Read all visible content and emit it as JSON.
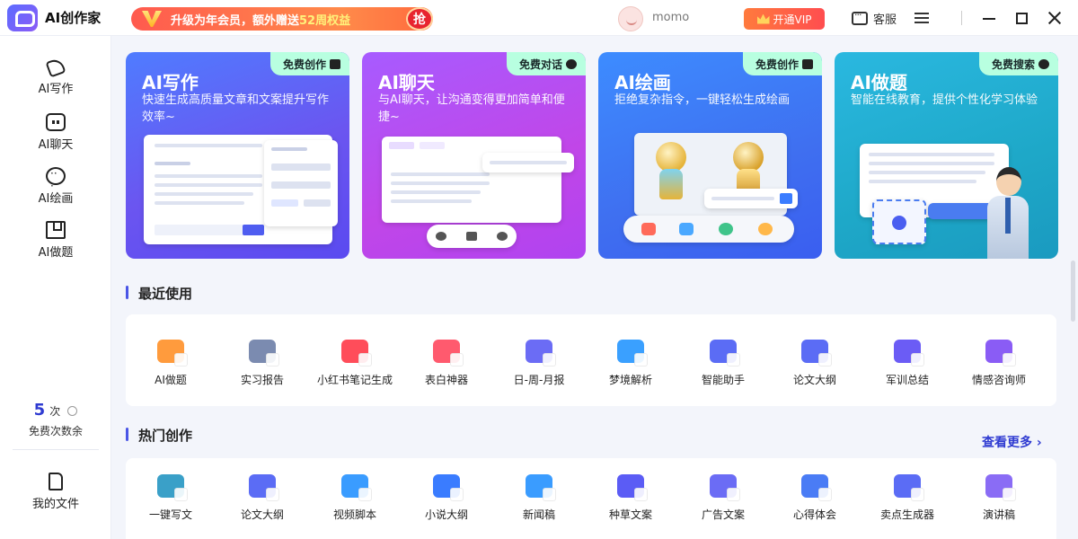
{
  "app": {
    "title": "AI创作家"
  },
  "banner": {
    "text_a": "升级为年会员，额外赠送",
    "text_highlight": "52周权益",
    "grab": "抢"
  },
  "user": {
    "name": "momo"
  },
  "header": {
    "vip_button": "开通VIP",
    "service": "客服"
  },
  "sidebar": {
    "items": [
      {
        "label": "AI写作",
        "icon": "pen-icon"
      },
      {
        "label": "AI聊天",
        "icon": "robot-icon"
      },
      {
        "label": "AI绘画",
        "icon": "palette-icon"
      },
      {
        "label": "AI做题",
        "icon": "book-icon"
      }
    ],
    "free_count": "5",
    "free_unit": "次",
    "free_label": "免费次数余",
    "files_label": "我的文件"
  },
  "cards": [
    {
      "title": "AI写作",
      "tag": "免费创作",
      "desc": "快速生成高质量文章和文案提升写作效率~",
      "color": "#5a63f0"
    },
    {
      "title": "AI聊天",
      "tag": "免费对话",
      "desc": "与AI聊天，让沟通变得更加简单和便捷~",
      "color": "#b94ee8"
    },
    {
      "title": "AI绘画",
      "tag": "免费创作",
      "desc": "拒绝复杂指令，一键轻松生成绘画",
      "color": "#3f6ff0"
    },
    {
      "title": "AI做题",
      "tag": "免费搜索",
      "desc": "智能在线教育，提供个性化学习体验",
      "color": "#1ea8c8"
    }
  ],
  "recent": {
    "title": "最近使用",
    "items": [
      {
        "label": "AI做题",
        "color": "#ff9b3d"
      },
      {
        "label": "实习报告",
        "color": "#7b8bb0"
      },
      {
        "label": "小红书笔记生成",
        "color": "#ff4d5a"
      },
      {
        "label": "表白神器",
        "color": "#ff5a6e"
      },
      {
        "label": "日-周-月报",
        "color": "#6b6cf5"
      },
      {
        "label": "梦境解析",
        "color": "#3aa0ff"
      },
      {
        "label": "智能助手",
        "color": "#5b6cf5"
      },
      {
        "label": "论文大纲",
        "color": "#5b6cf5"
      },
      {
        "label": "军训总结",
        "color": "#6b5cf5"
      },
      {
        "label": "情感咨询师",
        "color": "#8a5cf5"
      }
    ]
  },
  "hot": {
    "title": "热门创作",
    "see_more": "查看更多 ›",
    "items": [
      {
        "label": "一键写文",
        "color": "#3aa0c8"
      },
      {
        "label": "论文大纲",
        "color": "#5b6cf5"
      },
      {
        "label": "视频脚本",
        "color": "#3a9cff"
      },
      {
        "label": "小说大纲",
        "color": "#3a7cff"
      },
      {
        "label": "新闻稿",
        "color": "#3a9cff"
      },
      {
        "label": "种草文案",
        "color": "#5b5cf5"
      },
      {
        "label": "广告文案",
        "color": "#6b6cf5"
      },
      {
        "label": "心得体会",
        "color": "#4a7cf5"
      },
      {
        "label": "卖点生成器",
        "color": "#5b6cf5"
      },
      {
        "label": "演讲稿",
        "color": "#8a6cf5"
      }
    ]
  }
}
